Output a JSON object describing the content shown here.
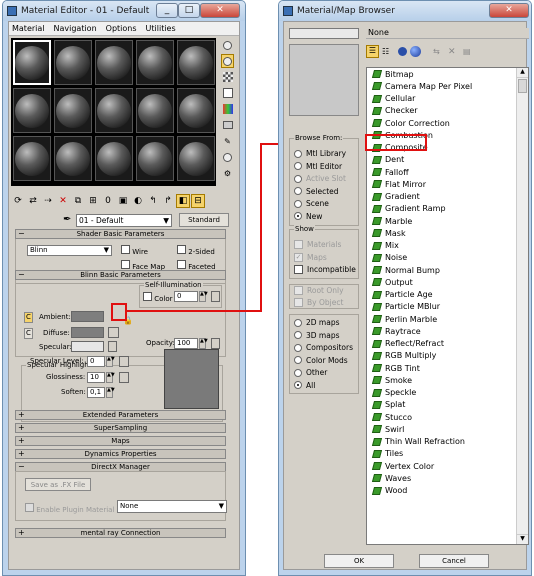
{
  "editor": {
    "title": "Material Editor - 01 - Default",
    "menu": [
      "Material",
      "Navigation",
      "Options",
      "Utilities"
    ],
    "material_name": "01 - Default",
    "type_button": "Standard",
    "shader_basic": {
      "title": "Shader Basic Parameters",
      "shader": "Blinn",
      "wire": "Wire",
      "two_sided": "2-Sided",
      "face_map": "Face Map",
      "faceted": "Faceted"
    },
    "blinn_basic": {
      "title": "Blinn Basic Parameters",
      "self_illum": "Self-Illumination",
      "color": "Color",
      "color_value": "0",
      "ambient": "Ambient:",
      "diffuse": "Diffuse:",
      "specular": "Specular:",
      "opacity": "Opacity:",
      "opacity_value": "100",
      "lock_c": "C",
      "lock_m": "M"
    },
    "specular_highlights": {
      "title": "Specular Highlights",
      "level_label": "Specular Level:",
      "level_value": "0",
      "gloss_label": "Glossiness:",
      "gloss_value": "10",
      "soften_label": "Soften:",
      "soften_value": "0,1"
    },
    "rollouts": [
      "Extended Parameters",
      "SuperSampling",
      "Maps",
      "Dynamics Properties",
      "DirectX Manager"
    ],
    "directx": {
      "save_fx": "Save as .FX File",
      "enable_plugin": "Enable Plugin Material",
      "plugin_value": "None"
    },
    "mental_ray": "mental ray Connection"
  },
  "browser": {
    "title": "Material/Map Browser",
    "current": "None",
    "browse_from_title": "Browse From:",
    "browse_from": [
      {
        "label": "Mtl Library",
        "on": false,
        "disabled": false
      },
      {
        "label": "Mtl Editor",
        "on": false,
        "disabled": false
      },
      {
        "label": "Active Slot",
        "on": false,
        "disabled": true
      },
      {
        "label": "Selected",
        "on": false,
        "disabled": false
      },
      {
        "label": "Scene",
        "on": false,
        "disabled": false
      },
      {
        "label": "New",
        "on": true,
        "disabled": false
      }
    ],
    "show_title": "Show",
    "show": [
      {
        "label": "Materials",
        "disabled": true,
        "checked": false
      },
      {
        "label": "Maps",
        "disabled": true,
        "checked": true
      },
      {
        "label": "Incompatible",
        "disabled": false,
        "checked": false
      }
    ],
    "root": [
      {
        "label": "Root Only",
        "disabled": true
      },
      {
        "label": "By Object",
        "disabled": true
      }
    ],
    "filter": [
      {
        "label": "2D maps",
        "on": false
      },
      {
        "label": "3D maps",
        "on": false
      },
      {
        "label": "Compositors",
        "on": false
      },
      {
        "label": "Color Mods",
        "on": false
      },
      {
        "label": "Other",
        "on": false
      },
      {
        "label": "All",
        "on": true
      }
    ],
    "maps": [
      "Bitmap",
      "Camera Map Per Pixel",
      "Cellular",
      "Checker",
      "Color Correction",
      "Combustion",
      "Composite",
      "Dent",
      "Falloff",
      "Flat Mirror",
      "Gradient",
      "Gradient Ramp",
      "Marble",
      "Mask",
      "Mix",
      "Noise",
      "Normal Bump",
      "Output",
      "Particle Age",
      "Particle MBlur",
      "Perlin Marble",
      "Raytrace",
      "Reflect/Refract",
      "RGB Multiply",
      "RGB Tint",
      "Smoke",
      "Speckle",
      "Splat",
      "Stucco",
      "Swirl",
      "Thin Wall Refraction",
      "Tiles",
      "Vertex Color",
      "Waves",
      "Wood"
    ],
    "selected_map": "Composite",
    "ok": "OK",
    "cancel": "Cancel"
  },
  "colors": {
    "highlight": "#e01010",
    "leaf": "#3a9a2a"
  }
}
